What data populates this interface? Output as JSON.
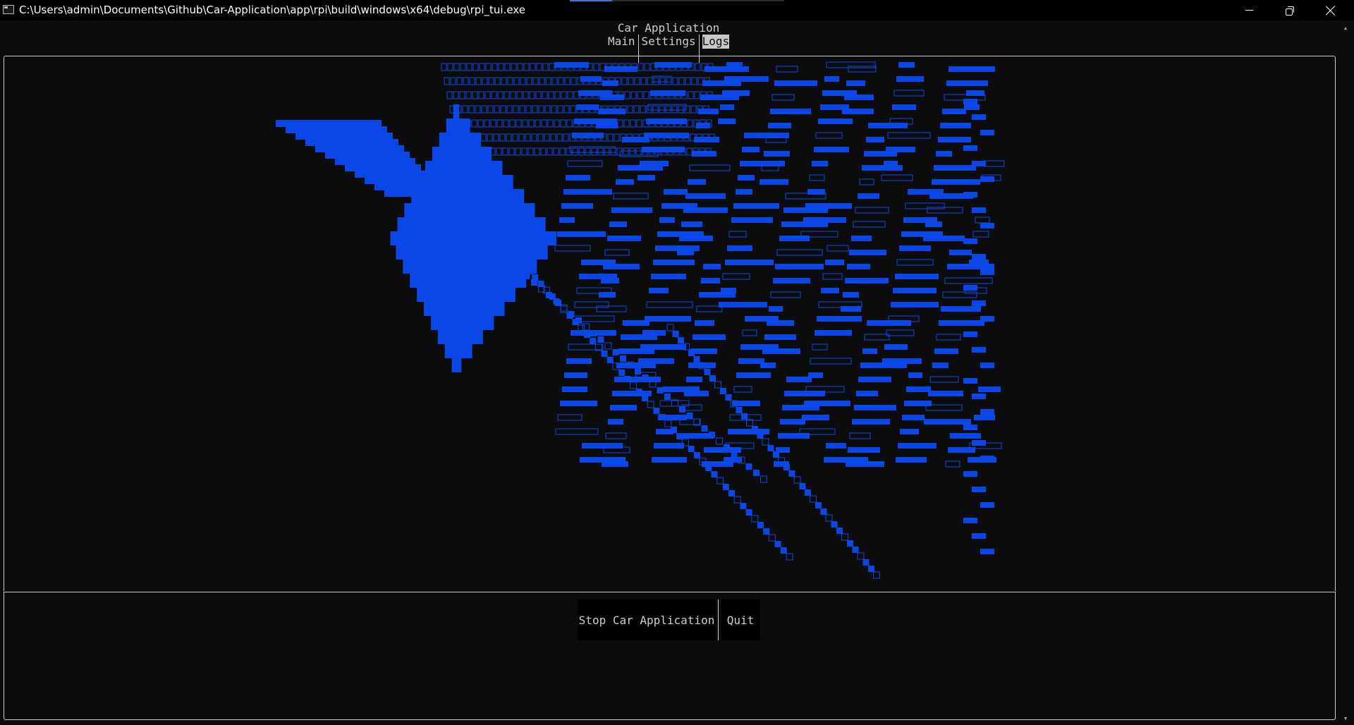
{
  "window": {
    "title": "C:\\Users\\admin\\Documents\\Github\\Car-Application\\app\\rpi\\build\\windows\\x64\\debug\\rpi_tui.exe"
  },
  "app": {
    "title": "Car Application",
    "tabs": [
      {
        "label": "Main",
        "active": false
      },
      {
        "label": "Settings",
        "active": false
      },
      {
        "label": "Logs",
        "active": true
      }
    ]
  },
  "log_panel": {
    "content_color": "#0a47e6",
    "background": "#0c0c0c"
  },
  "buttons": {
    "stop_label": "Stop Car Application",
    "quit_label": "Quit"
  },
  "colors": {
    "terminal_bg": "#0c0c0c",
    "text": "#cccccc",
    "active_tab_bg": "#c8c8c8",
    "glitch_blue": "#0a47e6"
  }
}
